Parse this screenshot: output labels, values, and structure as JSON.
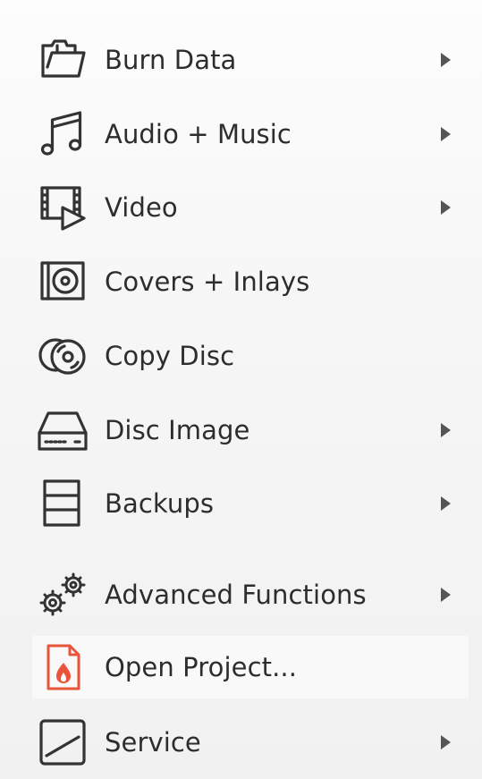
{
  "menu": {
    "items": [
      {
        "label": "Burn Data",
        "icon": "folder-open-icon",
        "submenu": true
      },
      {
        "label": "Audio + Music",
        "icon": "music-note-icon",
        "submenu": true
      },
      {
        "label": "Video",
        "icon": "video-film-icon",
        "submenu": true
      },
      {
        "label": "Covers + Inlays",
        "icon": "disc-cover-icon",
        "submenu": false
      },
      {
        "label": "Copy Disc",
        "icon": "copy-disc-icon",
        "submenu": false
      },
      {
        "label": "Disc Image",
        "icon": "disc-drive-icon",
        "submenu": true
      },
      {
        "label": "Backups",
        "icon": "backup-stack-icon",
        "submenu": true
      },
      {
        "label": "Advanced Functions",
        "icon": "gears-icon",
        "submenu": true
      },
      {
        "label": "Open Project...",
        "icon": "project-file-icon",
        "submenu": false,
        "highlighted": true
      },
      {
        "label": "Service",
        "icon": "service-icon",
        "submenu": true
      }
    ],
    "colors": {
      "icon_stroke": "#333333",
      "project_icon_accent": "#e8553a",
      "text": "#2d2d2d",
      "arrow": "#555555"
    }
  }
}
